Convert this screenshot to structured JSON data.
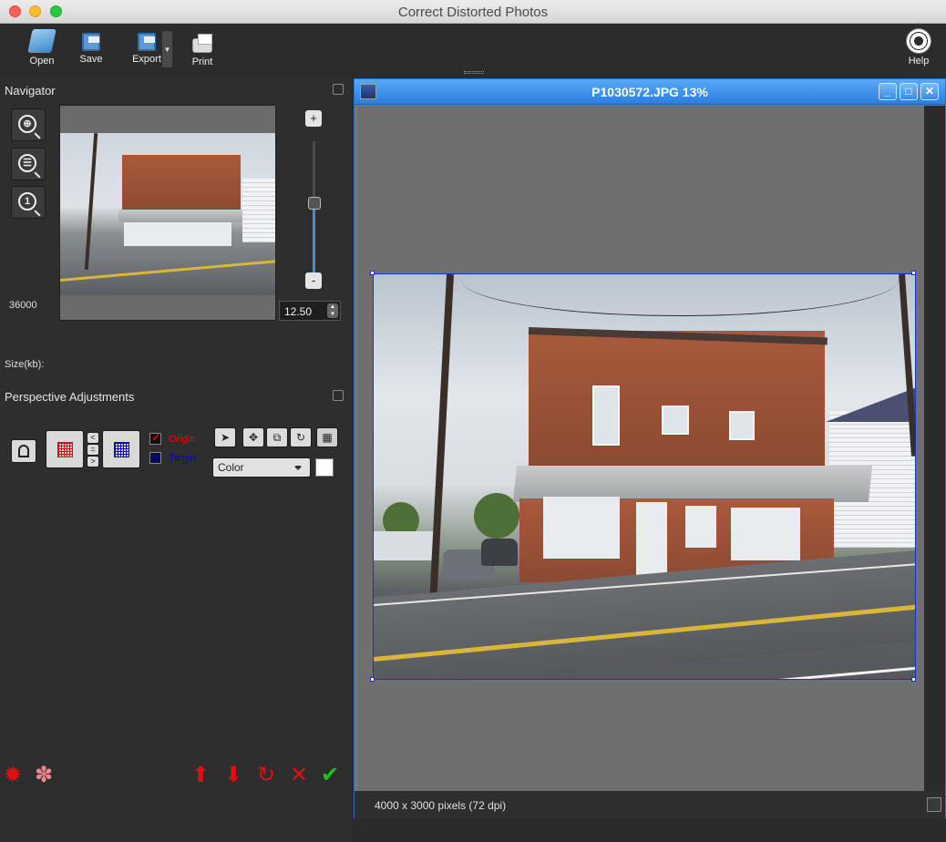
{
  "window": {
    "title": "Correct Distorted Photos"
  },
  "toolbar": {
    "open": "Open",
    "save": "Save",
    "export": "Export",
    "print": "Print",
    "help": "Help"
  },
  "navigator": {
    "title": "Navigator",
    "size_label": "Size(kb):",
    "size_value": "36000",
    "zoom_value": "12.50",
    "zoom_in": "+",
    "zoom_out": "-",
    "slider_level_fraction": 0.55
  },
  "perspective": {
    "title": "Perspective Adjustments",
    "origin_label": "Origin",
    "target_label": "Target",
    "origin_checked": true,
    "target_checked": false,
    "color_select": "Color",
    "swap_left": "<",
    "swap_equal": "=",
    "swap_right": ">",
    "origin_color": "#e00000",
    "target_color": "#0000d0"
  },
  "document": {
    "title": "P1030572.JPG 13%",
    "status": "4000 x 3000 pixels (72 dpi)"
  },
  "icons": {
    "open": "open-folder-icon",
    "save": "floppy-disk-icon",
    "export": "export-disk-icon",
    "print": "printer-icon",
    "help": "lifebuoy-icon"
  }
}
